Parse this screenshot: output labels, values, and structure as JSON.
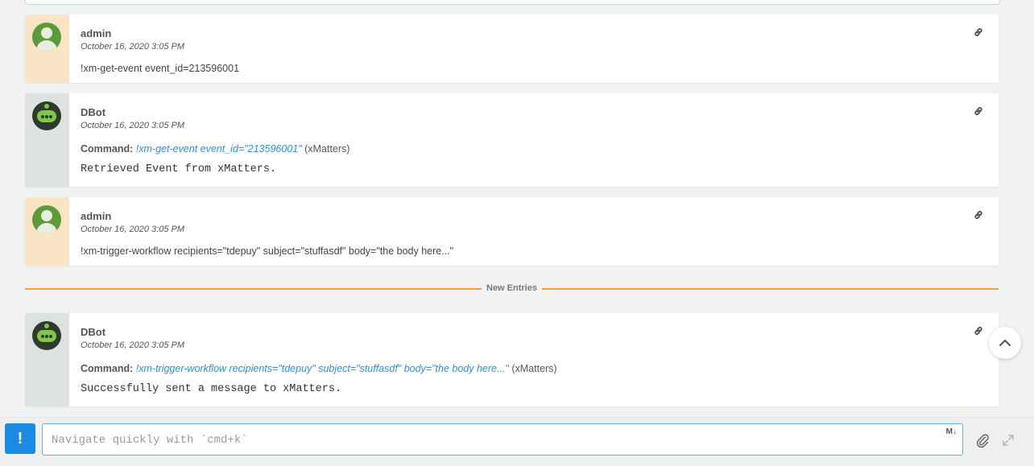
{
  "entries": [
    {
      "author": "admin",
      "time": "October 16, 2020 3:05 PM",
      "message": "!xm-get-event event_id=213596001"
    },
    {
      "author": "DBot",
      "time": "October 16, 2020 3:05 PM",
      "command_label": "Command:",
      "command": "!xm-get-event event_id=\"213596001\"",
      "integration": "(xMatters)",
      "result": "Retrieved Event from xMatters."
    },
    {
      "author": "admin",
      "time": "October 16, 2020 3:05 PM",
      "message": "!xm-trigger-workflow recipients=\"tdepuy\" subject=\"stuffasdf\" body=\"the body here...\""
    },
    {
      "author": "DBot",
      "time": "October 16, 2020 3:05 PM",
      "command_label": "Command:",
      "command": "!xm-trigger-workflow recipients=\"tdepuy\" subject=\"stuffasdf\" body=\"the body here...\"",
      "integration": "(xMatters)",
      "result": "Successfully sent a message to xMatters."
    }
  ],
  "divider": {
    "label": "New Entries"
  },
  "composer": {
    "button_label": "!",
    "placeholder": "Navigate quickly with `cmd+k`",
    "markdown_badge": "M↓"
  },
  "icons": {
    "entry_link": "link-icon",
    "user_avatar": "user-avatar-icon",
    "bot_avatar": "dbot-avatar-icon",
    "scroll_top": "chevron-up-icon",
    "attach": "paperclip-icon",
    "expand": "expand-icon"
  },
  "colors": {
    "accent": "#1a8ae2",
    "command_link": "#2f8ed8",
    "divider": "#f0a23a",
    "user_avatar_bg": "#fbe3c6",
    "bot_avatar_bg": "#dde2e1"
  }
}
